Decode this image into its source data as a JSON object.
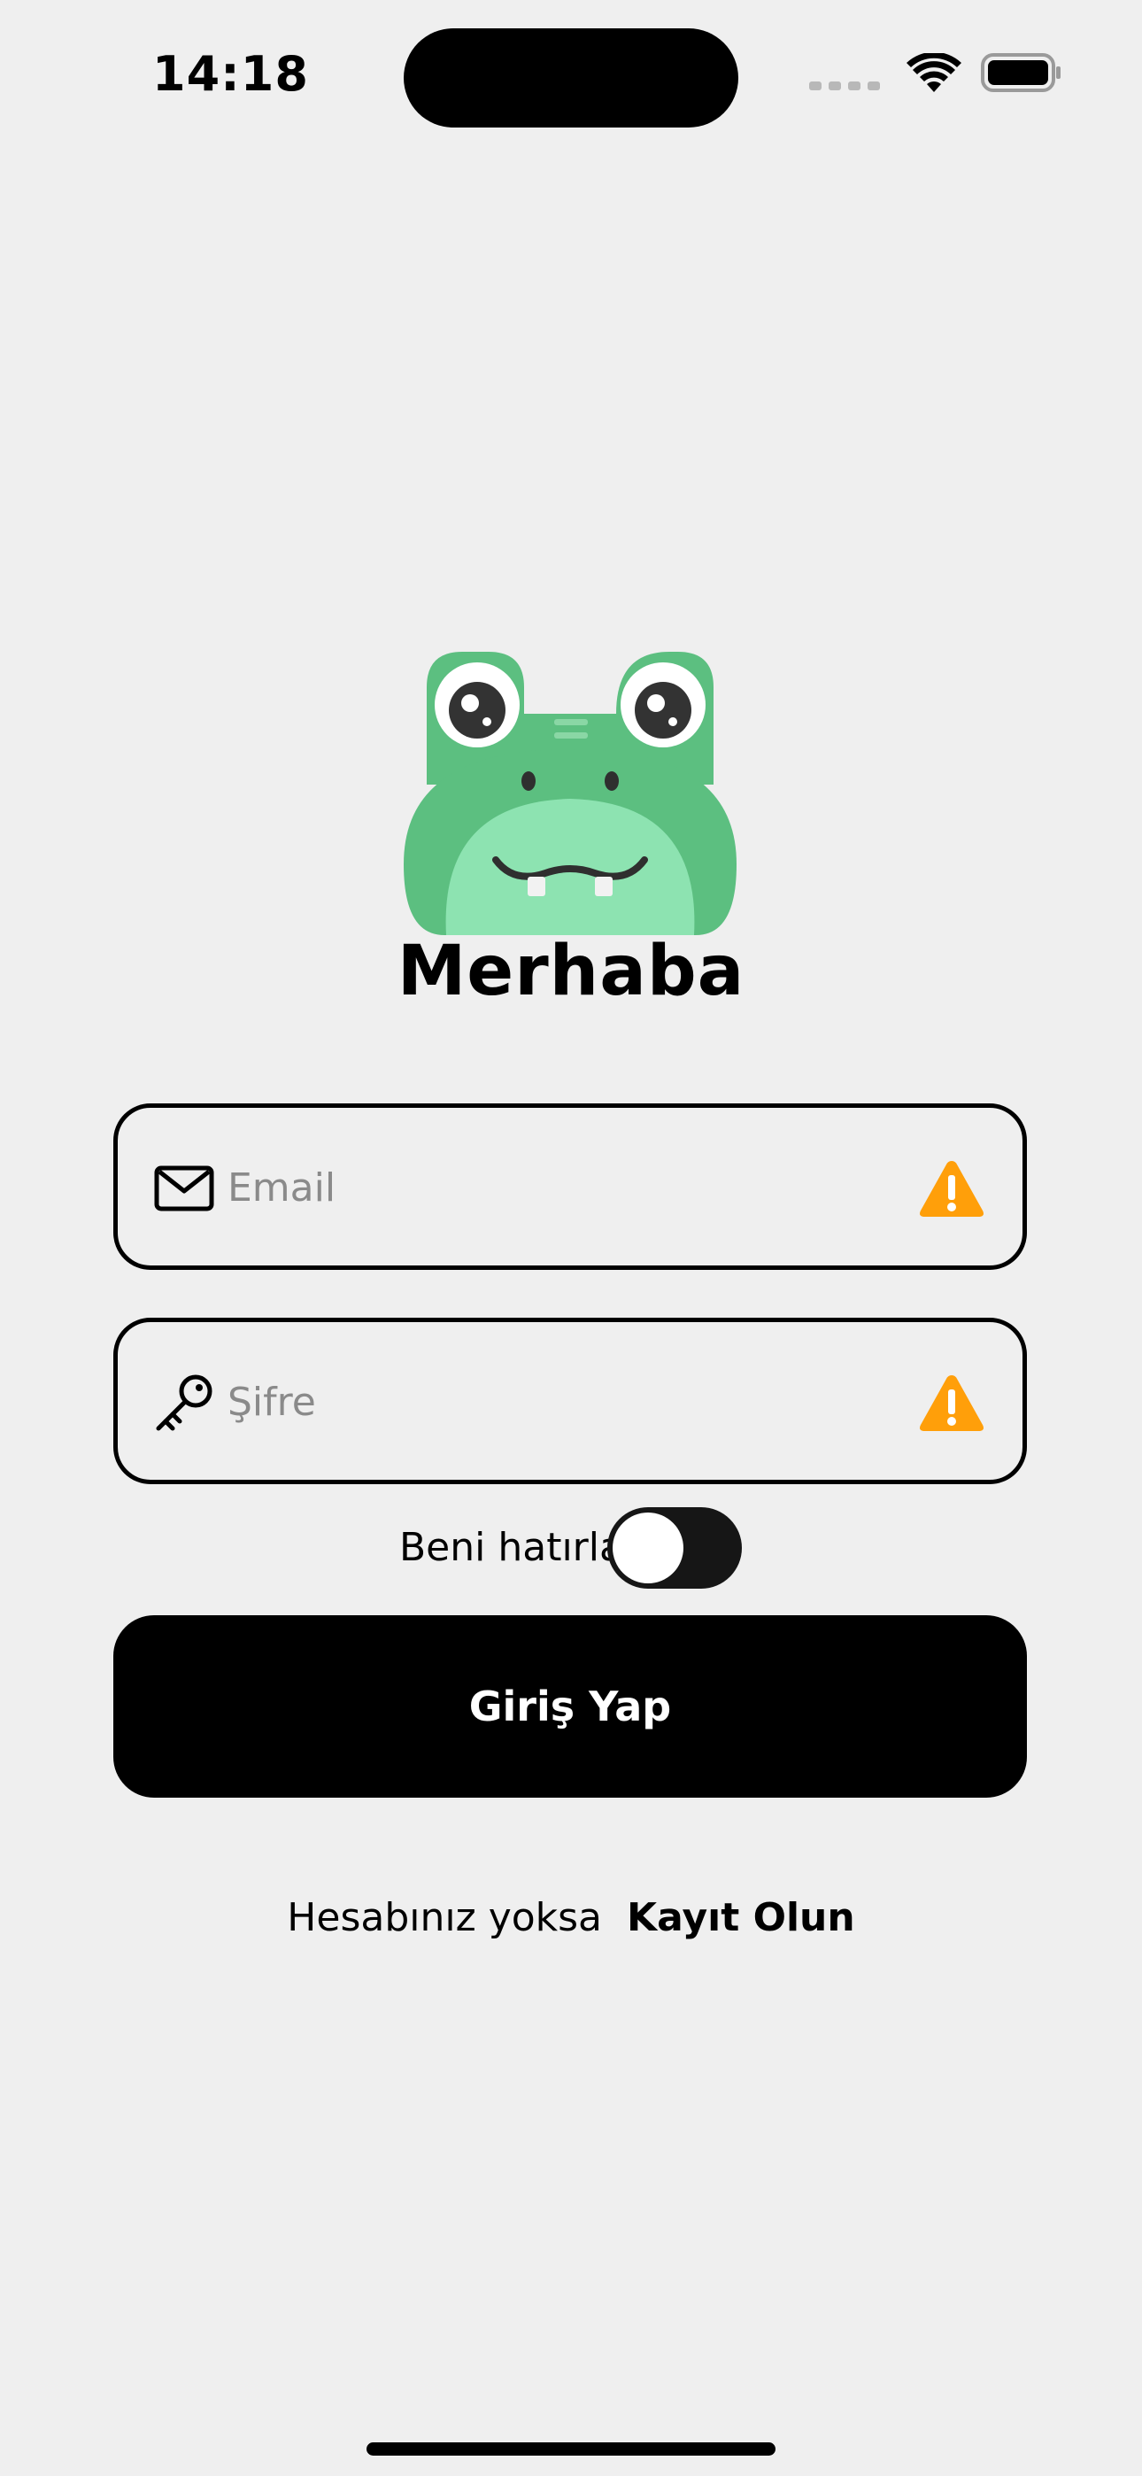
{
  "status_bar": {
    "time": "14:18"
  },
  "header": {
    "title": "Merhaba"
  },
  "form": {
    "email_placeholder": "Email",
    "password_placeholder": "Şifre",
    "remember_label": "Beni hatırla",
    "remember_on": false,
    "login_label": "Giriş Yap"
  },
  "footer": {
    "prompt": "Hesabınız yoksa",
    "signup_link": "Kayıt Olun"
  },
  "icons": {
    "email": "envelope-icon",
    "password": "key-icon",
    "warning": "warning-triangle-icon"
  },
  "colors": {
    "background": "#efefef",
    "primary": "#000000",
    "warning": "#ff9f0a",
    "mascot_green": "#5cbf80"
  }
}
